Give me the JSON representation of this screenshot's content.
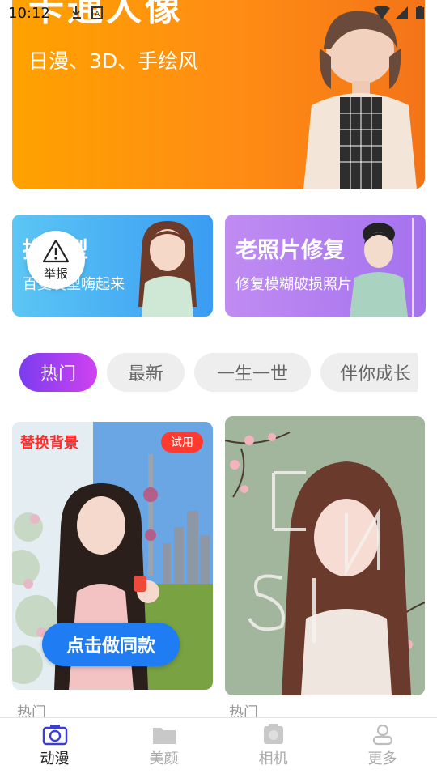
{
  "status": {
    "time": "10:12"
  },
  "hero": {
    "title": "卡通人像",
    "subtitle": "日漫、3D、手绘风"
  },
  "cards": [
    {
      "title": "换发型",
      "subtitle": "百变发型嗨起来"
    },
    {
      "title": "老照片修复",
      "subtitle": "修复模糊破损照片"
    }
  ],
  "report": {
    "label": "举报"
  },
  "tabs": [
    {
      "label": "热门",
      "active": true
    },
    {
      "label": "最新",
      "active": false
    },
    {
      "label": "一生一世",
      "active": false
    },
    {
      "label": "伴你成长",
      "active": false
    }
  ],
  "tiles": [
    {
      "badge": "替换背景",
      "trial": "试用",
      "cta": "点击做同款",
      "caption": "热门"
    },
    {
      "caption": "热门"
    }
  ],
  "bottom_nav": [
    {
      "label": "动漫",
      "icon": "camera-icon",
      "active": true
    },
    {
      "label": "美颜",
      "icon": "folder-icon",
      "active": false
    },
    {
      "label": "相机",
      "icon": "camera-square-icon",
      "active": false
    },
    {
      "label": "更多",
      "icon": "user-icon",
      "active": false
    }
  ],
  "colors": {
    "hero_orange": "#ff9a0f",
    "card_blue": "#4aaef3",
    "card_purple": "#b37df0",
    "tab_active_gradient_start": "#7b3cf0",
    "tab_active_gradient_end": "#d042f0",
    "cta_blue": "#1f7cf3",
    "trial_red": "#ff3b30",
    "nav_active": "#3a3dd6"
  }
}
